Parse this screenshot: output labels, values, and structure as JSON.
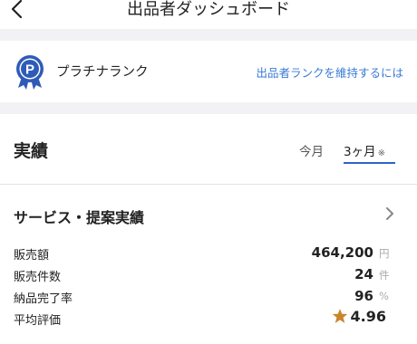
{
  "header": {
    "title": "出品者ダッシュボード"
  },
  "rank": {
    "label": "プラチナランク",
    "link": "出品者ランクを維持するには",
    "badge_letter": "P"
  },
  "performance": {
    "title": "実績",
    "tabs": [
      {
        "label": "今月",
        "active": false
      },
      {
        "label": "3ヶ月",
        "note": "※",
        "active": true
      }
    ],
    "section_title": "サービス・提案実績",
    "metrics": [
      {
        "label": "販売額",
        "value": "464,200",
        "unit": "円"
      },
      {
        "label": "販売件数",
        "value": "24",
        "unit": "件"
      },
      {
        "label": "納品完了率",
        "value": "96",
        "unit": "%"
      },
      {
        "label": "平均評価",
        "value": "4.96",
        "unit": ""
      }
    ]
  },
  "colors": {
    "accent": "#2d63c8",
    "link": "#3a7bd5",
    "badge": "#2f5bb8",
    "star": "#c8862a"
  },
  "icons": [
    "back-arrow-icon",
    "rank-badge-icon",
    "chevron-right-icon",
    "star-icon"
  ]
}
